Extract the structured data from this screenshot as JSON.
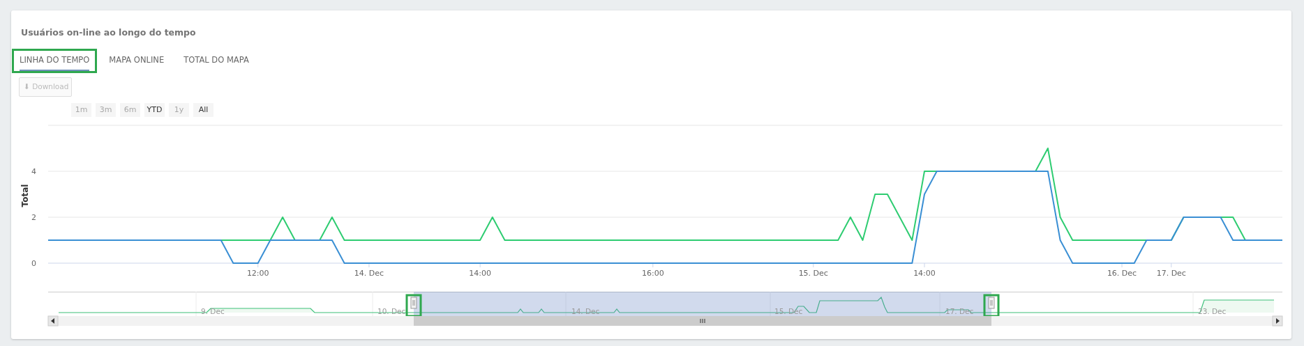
{
  "card": {
    "title": "Usuários on-line ao longo do tempo"
  },
  "tabs": [
    {
      "label": "LINHA DO TEMPO",
      "selected": true,
      "highlighted": true
    },
    {
      "label": "MAPA ONLINE",
      "selected": false,
      "highlighted": false
    },
    {
      "label": "TOTAL DO MAPA",
      "selected": false,
      "highlighted": false
    }
  ],
  "download_button": {
    "icon": "⬇",
    "label": "Download",
    "disabled": true
  },
  "range_buttons": [
    {
      "label": "1m",
      "disabled": true
    },
    {
      "label": "3m",
      "disabled": true
    },
    {
      "label": "6m",
      "disabled": true
    },
    {
      "label": "YTD",
      "disabled": false
    },
    {
      "label": "1y",
      "disabled": true
    },
    {
      "label": "All",
      "disabled": false
    }
  ],
  "chart": {
    "chart_data": {
      "type": "line",
      "ylabel": "Total",
      "categories": [
        null,
        null,
        null,
        null,
        null,
        null,
        null,
        null,
        null,
        null,
        null,
        null,
        null,
        null,
        null,
        null,
        null,
        "12:00",
        null,
        null,
        null,
        null,
        null,
        null,
        null,
        null,
        "14. Dec",
        null,
        null,
        null,
        null,
        null,
        null,
        null,
        null,
        "14:00",
        null,
        null,
        null,
        null,
        null,
        null,
        null,
        null,
        null,
        null,
        null,
        null,
        null,
        "16:00",
        null,
        null,
        null,
        null,
        null,
        null,
        null,
        null,
        null,
        null,
        null,
        null,
        "15. Dec",
        null,
        null,
        null,
        null,
        null,
        null,
        null,
        null,
        "14:00",
        null,
        null,
        null,
        null,
        null,
        null,
        null,
        null,
        null,
        null,
        null,
        null,
        null,
        null,
        null,
        "16. Dec",
        null,
        null,
        null,
        "17. Dec",
        null,
        null,
        null,
        null,
        null,
        null,
        null,
        null,
        null
      ],
      "series": [
        {
          "color": "#2ecc71",
          "values": [
            null,
            null,
            null,
            null,
            null,
            null,
            null,
            null,
            null,
            null,
            null,
            null,
            null,
            1,
            1,
            1,
            1,
            1,
            1,
            2,
            1,
            1,
            1,
            2,
            1,
            1,
            1,
            1,
            1,
            1,
            1,
            1,
            1,
            1,
            1,
            1,
            2,
            1,
            1,
            1,
            1,
            1,
            1,
            1,
            1,
            1,
            1,
            1,
            1,
            1,
            1,
            1,
            1,
            1,
            1,
            1,
            1,
            1,
            1,
            1,
            1,
            1,
            1,
            1,
            1,
            2,
            1,
            3,
            3,
            2,
            1,
            4,
            4,
            4,
            4,
            4,
            4,
            4,
            4,
            4,
            4,
            5,
            2,
            1,
            1,
            1,
            1,
            1,
            1,
            1,
            1,
            1,
            2,
            2,
            2,
            2,
            2,
            1,
            1,
            null,
            null
          ]
        },
        {
          "color": "#3a8fd4",
          "values": [
            1,
            1,
            1,
            1,
            1,
            1,
            1,
            1,
            1,
            1,
            1,
            1,
            1,
            1,
            1,
            0,
            0,
            0,
            1,
            1,
            1,
            1,
            1,
            1,
            0,
            0,
            0,
            0,
            0,
            0,
            0,
            0,
            0,
            0,
            0,
            0,
            0,
            0,
            0,
            0,
            0,
            0,
            0,
            0,
            0,
            0,
            0,
            0,
            0,
            0,
            0,
            0,
            0,
            0,
            0,
            0,
            0,
            0,
            0,
            0,
            0,
            0,
            0,
            0,
            0,
            0,
            0,
            0,
            0,
            0,
            0,
            3,
            4,
            4,
            4,
            4,
            4,
            4,
            4,
            4,
            4,
            4,
            1,
            0,
            0,
            0,
            0,
            0,
            0,
            1,
            1,
            1,
            2,
            2,
            2,
            2,
            1,
            1,
            1,
            1,
            1
          ]
        }
      ],
      "ylim": [
        0,
        6
      ],
      "yticks": [
        0,
        2,
        4
      ]
    }
  },
  "navigator": {
    "labels": [
      "9. Dec",
      "10. Dec",
      "14. Dec",
      "15. Dec",
      "17. Dec",
      "23. Dec"
    ],
    "handles": [
      {
        "highlighted": true
      },
      {
        "highlighted": true
      }
    ]
  }
}
